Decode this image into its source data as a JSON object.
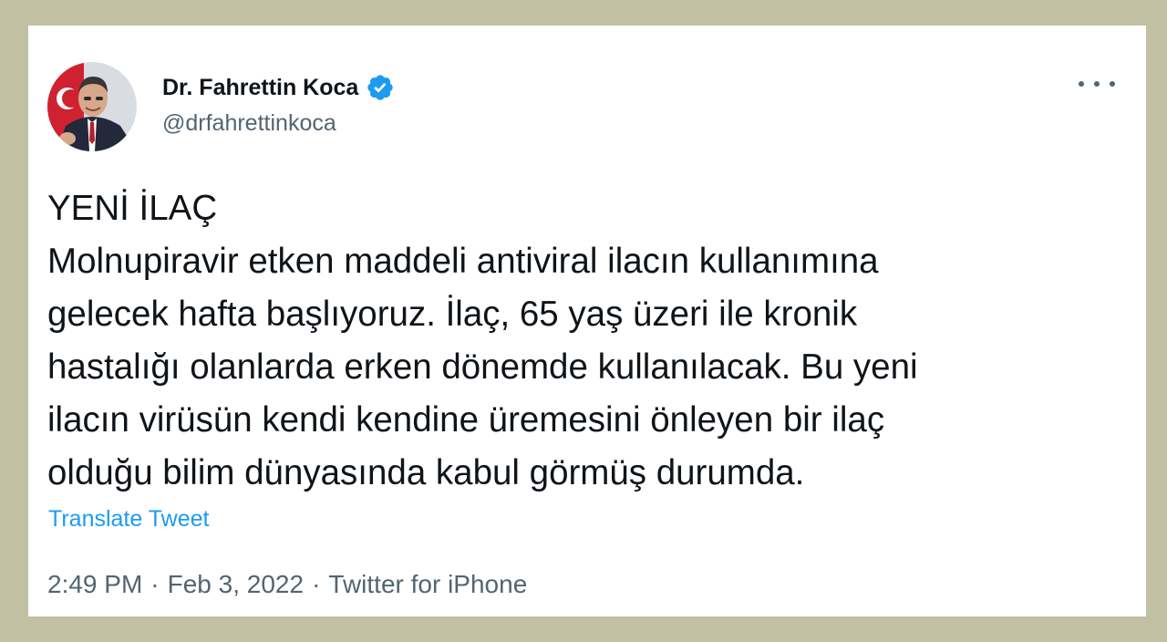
{
  "author": {
    "name": "Dr. Fahrettin Koca",
    "handle": "@drfahrettinkoca",
    "verified": true,
    "avatar_icon": "profile-photo"
  },
  "more_icon": "more-options-icon",
  "tweet": {
    "lines": [
      "YENİ İLAÇ",
      "Molnupiravir etken maddeli antiviral ilacın kullanımına",
      "gelecek hafta başlıyoruz. İlaç, 65 yaş üzeri ile kronik",
      "hastalığı olanlarda erken dönemde kullanılacak. Bu yeni",
      "ilacın virüsün kendi kendine üremesini önleyen bir ilaç",
      "olduğu bilim dünyasında kabul görmüş durumda."
    ],
    "translate_label": "Translate Tweet",
    "time": "2:49 PM",
    "separator": "·",
    "date": "Feb 3, 2022",
    "source": "Twitter for iPhone"
  },
  "colors": {
    "frame": "#c2c0a3",
    "card": "#ffffff",
    "text": "#0f1419",
    "secondary": "#536471",
    "link": "#1d9bf0",
    "verified": "#1d9bf0"
  }
}
